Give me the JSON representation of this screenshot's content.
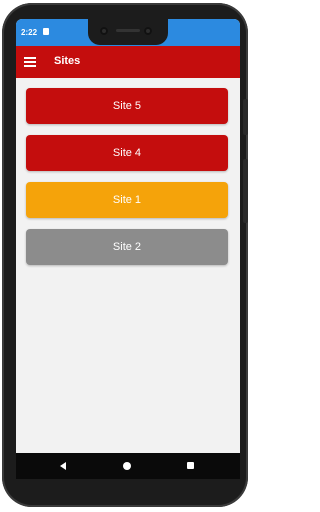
{
  "status_bar": {
    "time": "2:22",
    "icon": "notification-icon",
    "color": "#2c8ae0"
  },
  "app_bar": {
    "title": "Sites",
    "menu_icon": "hamburger-menu-icon",
    "color": "#c40d0d"
  },
  "sites": [
    {
      "label": "Site 5",
      "color": "#c40d0d"
    },
    {
      "label": "Site 4",
      "color": "#c40d0d"
    },
    {
      "label": "Site 1",
      "color": "#f5a30a"
    },
    {
      "label": "Site 2",
      "color": "#8c8c8c"
    }
  ],
  "nav_bar": {
    "back_icon": "back-icon",
    "home_icon": "home-icon",
    "recents_icon": "recents-icon"
  }
}
